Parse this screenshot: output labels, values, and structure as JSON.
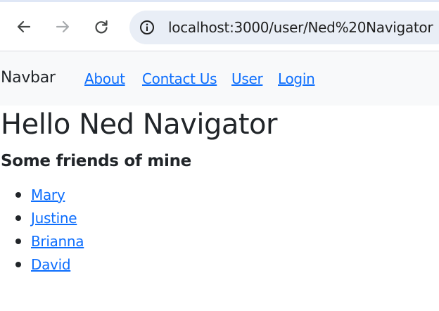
{
  "browser": {
    "url": "localhost:3000/user/Ned%20Navigator",
    "icons": {
      "back": "arrow-left-icon",
      "forward": "arrow-right-icon",
      "reload": "reload-icon",
      "site_info": "info-circle-icon"
    }
  },
  "navbar": {
    "brand": "Navbar",
    "links": [
      "About",
      "Contact Us",
      "User",
      "Login"
    ],
    "link_color": "#0d6efd",
    "background": "#f8f9fa"
  },
  "main": {
    "heading": "Hello Ned Navigator",
    "subheading": "Some friends of mine",
    "friends": [
      "Mary",
      "Justine",
      "Brianna",
      "David"
    ]
  }
}
